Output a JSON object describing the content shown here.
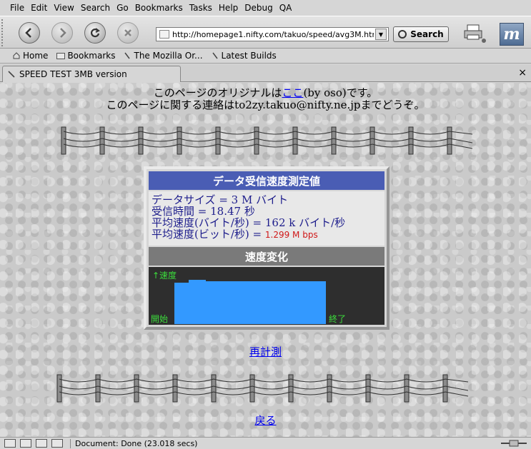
{
  "menu": [
    "File",
    "Edit",
    "View",
    "Search",
    "Go",
    "Bookmarks",
    "Tasks",
    "Help",
    "Debug",
    "QA"
  ],
  "toolbar": {
    "url": "http://homepage1.nifty.com/takuo/speed/avg3M.htm",
    "search_label": "Search"
  },
  "personal_toolbar": {
    "home": "Home",
    "bookmarks": "Bookmarks",
    "mozilla": "The Mozilla Or...",
    "latest": "Latest Builds"
  },
  "tab": {
    "title": "SPEED TEST 3MB version",
    "close": "×"
  },
  "intro": {
    "line1_pre": "このページのオリジナルは",
    "line1_link": "ここ",
    "line1_post": "(by oso)です。",
    "line2": "このページに関する連絡はto2zy.takuo@nifty.ne.jpまでどうぞ。"
  },
  "panel": {
    "header": "データ受信速度測定値",
    "size_line": "データサイズ = 3 M バイト",
    "time_line": "受信時間 = 18.47 秒",
    "avg_byte_line": "平均速度(バイト/秒) = 162 k バイト/秒",
    "avg_bit_pre": "平均速度(ビット/秒) = ",
    "avg_bit_value": "1.299 M bps",
    "chart_header": "速度変化",
    "axis_speed": "↑速度",
    "axis_start": "開始",
    "axis_end": "終了"
  },
  "links": {
    "remeasure": "再計測",
    "back": "戻る"
  },
  "status": {
    "text": "Document: Done (23.018 secs)"
  },
  "colors": {
    "panel_header": "#4a5db4",
    "chart_bar": "#3399ff",
    "link": "#0000ee",
    "accent_red": "#d01818"
  }
}
